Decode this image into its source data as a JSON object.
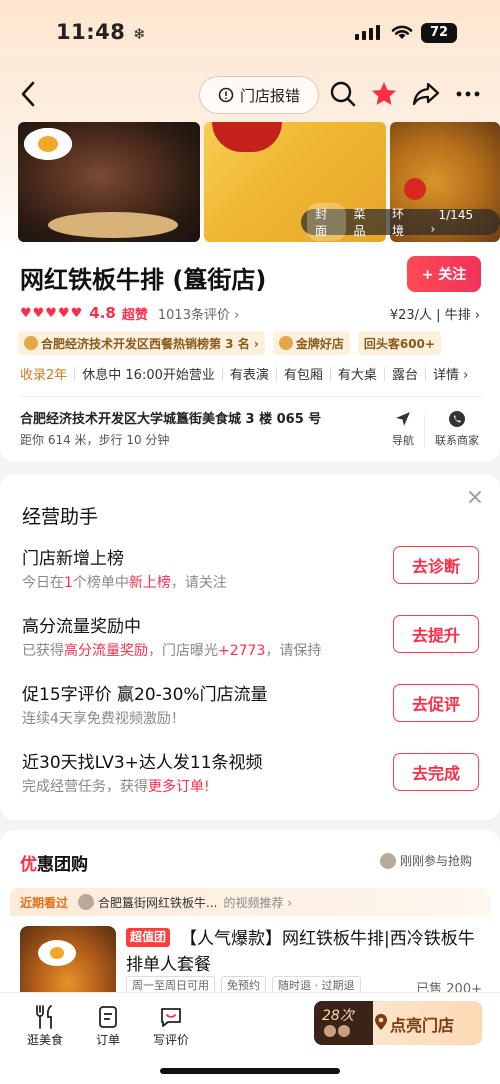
{
  "status": {
    "time": "11:48",
    "focus_glyph": "❄",
    "battery": "72"
  },
  "nav": {
    "report_label": "门店报错",
    "report_icon": "info-circle-icon"
  },
  "photos": {
    "tabs": [
      "封面",
      "菜品",
      "环境"
    ],
    "counter": "1/145"
  },
  "shop": {
    "name": "网红铁板牛排 (簋街店)",
    "follow_label": "+ 关注",
    "hearts": "♥♥♥♥♥",
    "score": "4.8",
    "score_word": "超赞",
    "reviews": "1013条评价 ›",
    "price": "¥23/人 | 牛排 ›",
    "badges": [
      "合肥经济技术开发区西餐热销榜第 3 名 ›",
      "金牌好店",
      "回头客600+"
    ],
    "info": {
      "years": "收录2年",
      "hours": "休息中 16:00开始营业",
      "tags": [
        "有表演",
        "有包厢",
        "有大桌",
        "露台"
      ],
      "more": "详情 ›"
    },
    "address": "合肥经济技术开发区大学城簋街美食城 3 楼 065 号",
    "distance": "距你 614 米，步行 10 分钟",
    "actions": {
      "navigate": "导航",
      "contact": "联系商家"
    }
  },
  "assistant": {
    "title": "经营助手",
    "tasks": [
      {
        "title": "门店新增上榜",
        "sub_pre": "今日在",
        "sub_hl1": "1",
        "sub_mid": "个榜单中",
        "sub_hl2": "新上榜",
        "sub_post": "，请关注",
        "button": "去诊断"
      },
      {
        "title": "高分流量奖励中",
        "sub_pre": "已获得",
        "sub_hl1": "高分流量奖励",
        "sub_mid": "，门店曝光",
        "sub_hl2": "+2773",
        "sub_post": "，请保持",
        "button": "去提升"
      },
      {
        "title": "促15字评价 赢20-30%门店流量",
        "sub_pre": "连续4天享免费视频激励！",
        "button": "去促评"
      },
      {
        "title": "近30天找LV3+达人发11条视频",
        "sub_pre": "完成经营任务，获得",
        "sub_hl1": "更多订单!",
        "button": "去完成"
      }
    ]
  },
  "deals": {
    "title_first": "优",
    "title_rest": "惠团购",
    "recent": "刚刚参与抢购",
    "recent_label": "近期看过",
    "recent_who": "合肥簋街网红铁板牛...",
    "recent_rec": "的视频推荐 ›",
    "item": {
      "tag": "超值团",
      "name": "【人气爆款】网红铁板牛排|西冷铁板牛排单人套餐",
      "tags": [
        "周一至周日可用",
        "免预约",
        "随时退 · 过期退"
      ],
      "sold": "已售 200+"
    }
  },
  "bottom": {
    "tabs": [
      "逛美食",
      "订单",
      "写评价"
    ],
    "light_count": "28次",
    "light_label": "点亮门店"
  }
}
